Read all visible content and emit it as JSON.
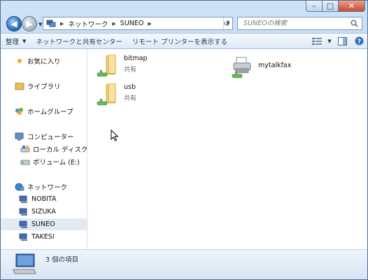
{
  "address": {
    "crumbs": [
      "ネットワーク",
      "SUNEO"
    ]
  },
  "search": {
    "placeholder": "SUNEOの検索"
  },
  "toolbar": {
    "organize": "整理",
    "network_center": "ネットワークと共有センター",
    "remote_printers": "リモート プリンターを表示する"
  },
  "nav": {
    "favorites": "お気に入り",
    "libraries": "ライブラリ",
    "homegroup": "ホームグループ",
    "computer": "コンピューター",
    "local_disk": "ローカル ディスク (",
    "volume": "ボリューム (E:)",
    "network": "ネットワーク",
    "hosts": [
      "NOBITA",
      "SIZUKA",
      "SUNEO",
      "TAKESI"
    ]
  },
  "items": [
    {
      "name": "bitmap",
      "sub": "共有",
      "icon": "shared-folder-icon"
    },
    {
      "name": "usb",
      "sub": "共有",
      "icon": "shared-folder-icon"
    },
    {
      "name": "mytalkfax",
      "sub": "",
      "icon": "printer-icon"
    }
  ],
  "status": {
    "count_text": "3 個の項目"
  },
  "colors": {
    "accent": "#2c6fbd",
    "selection": "#e3eaf2"
  }
}
